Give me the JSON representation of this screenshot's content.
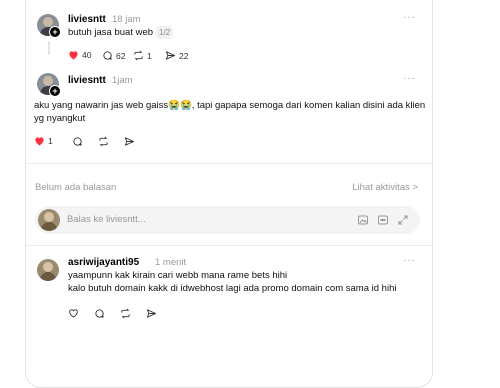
{
  "post1": {
    "username": "liviesntt",
    "time": "18 jam",
    "text": "butuh jasa buat web",
    "badge": "1/2",
    "likes": "40",
    "comments": "62",
    "reposts": "1",
    "shares": "22"
  },
  "post2": {
    "username": "liviesntt",
    "time": "1jam",
    "text": "aku yang nawarin jas web gaiss😭😭, tapi gapapa semoga dari komen kalian disini ada klien yg nyangkut",
    "likes": "1"
  },
  "status": {
    "no_replies": "Belum ada balasan",
    "view_activity": "Lihat aktivitas >"
  },
  "reply_box": {
    "placeholder": "Balas ke liviesntt..."
  },
  "reply": {
    "username": "asriwijayanti95",
    "time": "1 menit",
    "line1": "yaampunn kak kirain cari webb mana rame bets hihi",
    "line2": "kalo butuh domain kakk di idwebhost lagi ada promo domain com sama id hihi"
  },
  "more_label": "···",
  "colors": {
    "like_red": "#ff3040",
    "muted": "#999999"
  }
}
